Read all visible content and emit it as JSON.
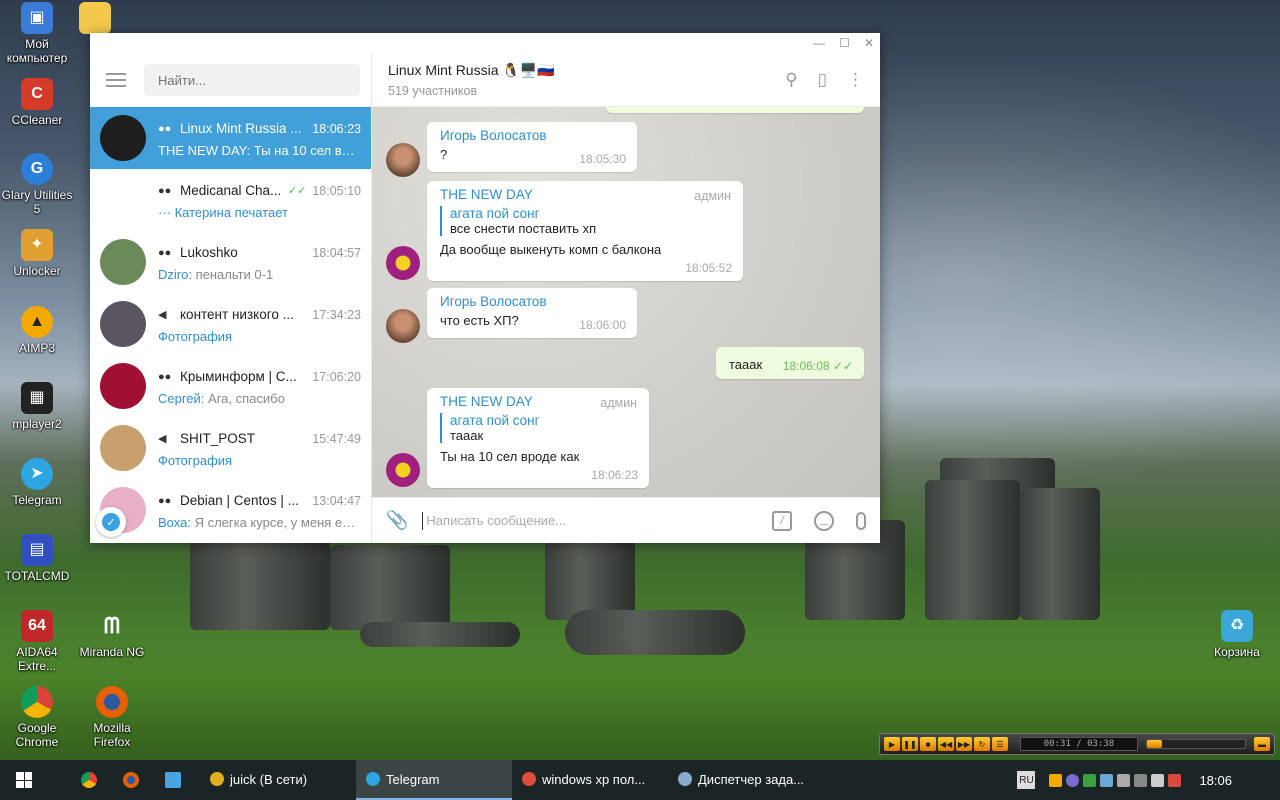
{
  "desktop": {
    "icons": [
      {
        "label": "Мой компьютер",
        "color": "#3a7bd5"
      },
      {
        "label": "CCleaner",
        "color": "#d43a2a"
      },
      {
        "label": "Glary Utilities 5",
        "color": "#2c7fd8"
      },
      {
        "label": "Unlocker",
        "color": "#e0a030"
      },
      {
        "label": "AIMP3",
        "color": "#f2a900"
      },
      {
        "label": "mplayer2",
        "color": "#222222"
      },
      {
        "label": "Telegram",
        "color": "#2ca5e0"
      },
      {
        "label": "TOTALCMD",
        "color": "#c83030"
      },
      {
        "label": "AIDA64 Extre...",
        "color": "#c0282b"
      },
      {
        "label": "Miranda NG",
        "color": "#2a6fba"
      },
      {
        "label": "Google Chrome",
        "color": "#4285f4"
      },
      {
        "label": "Mozilla Firefox",
        "color": "#e66000"
      },
      {
        "label": "Корзина",
        "color": "#3aa7d8"
      }
    ]
  },
  "window": {
    "controls": {
      "minimize": "—",
      "maximize": "☐",
      "close": "✕"
    }
  },
  "sidebar": {
    "search_placeholder": "Найти...",
    "chats": [
      {
        "name": "Linux Mint Russia ...",
        "time": "18:06:23",
        "preview_who": "",
        "preview": "THE NEW DAY: Ты на 10 сел вро...",
        "type": "group",
        "active": true,
        "avatar_color": "#1e1e1e"
      },
      {
        "name": "Medicanal Cha...",
        "time": "18:05:10",
        "preview_who": "··· Катерина печатает",
        "preview": "",
        "type": "group",
        "checked": true,
        "avatar_color": "#ffffff"
      },
      {
        "name": "Lukoshko",
        "time": "18:04:57",
        "preview_who": "Dziro:",
        "preview": " пенальти 0-1",
        "type": "group",
        "avatar_color": "#6a8a5a"
      },
      {
        "name": "контент низкого ...",
        "time": "17:34:23",
        "preview_who": "Фотография",
        "preview": "",
        "type": "channel",
        "avatar_color": "#5a5560"
      },
      {
        "name": "Крыминформ | С...",
        "time": "17:06:20",
        "preview_who": "Сергей:",
        "preview": " Ага, спасибо",
        "type": "group",
        "avatar_color": "#a01030"
      },
      {
        "name": "SHIT_POST",
        "time": "15:47:49",
        "preview_who": "Фотография",
        "preview": "",
        "type": "channel",
        "avatar_color": "#c8a070"
      },
      {
        "name": "Debian | Centos | ...",
        "time": "13:04:47",
        "preview_who": "Воха:",
        "preview": " Я слегка курсе, у меня ест...",
        "type": "group",
        "avatar_color": "#e8b0c8"
      }
    ]
  },
  "chat": {
    "title": "Linux Mint Russia 🐧🖥️🇷🇺",
    "subtitle": "519 участников",
    "composer_placeholder": "Написать сообщение...",
    "messages": [
      {
        "sender": "Игорь Волосатов",
        "text": "?",
        "time": "18:05:30"
      },
      {
        "sender": "THE NEW DAY",
        "role": "админ",
        "reply_name": "агата пой сонг",
        "reply_text": "все снести поставить хп",
        "text": "Да вообще выкенуть комп с балкона",
        "time": "18:05:52"
      },
      {
        "sender": "Игорь Волосатов",
        "text": "что есть ХП?",
        "time": "18:06:00"
      },
      {
        "text": "тааак",
        "time": "18:06:08",
        "out": true
      },
      {
        "sender": "THE NEW DAY",
        "role": "админ",
        "reply_name": "агата пой сонг",
        "reply_text": "тааак",
        "text": "Ты на 10 сел вроде как",
        "time": "18:06:23"
      }
    ]
  },
  "player": {
    "time": "00:31 / 03:38",
    "progress_fraction": 0.15
  },
  "taskbar": {
    "tasks": [
      {
        "label": "juick (В сети)",
        "color": "#e0b020"
      },
      {
        "label": "Telegram",
        "color": "#2ca5e0",
        "active": true
      },
      {
        "label": "windows xp пол...",
        "color": "#dd4b39"
      },
      {
        "label": "Диспетчер зада...",
        "color": "#88aacc"
      }
    ],
    "lang": "RU",
    "clock": "18:06"
  }
}
